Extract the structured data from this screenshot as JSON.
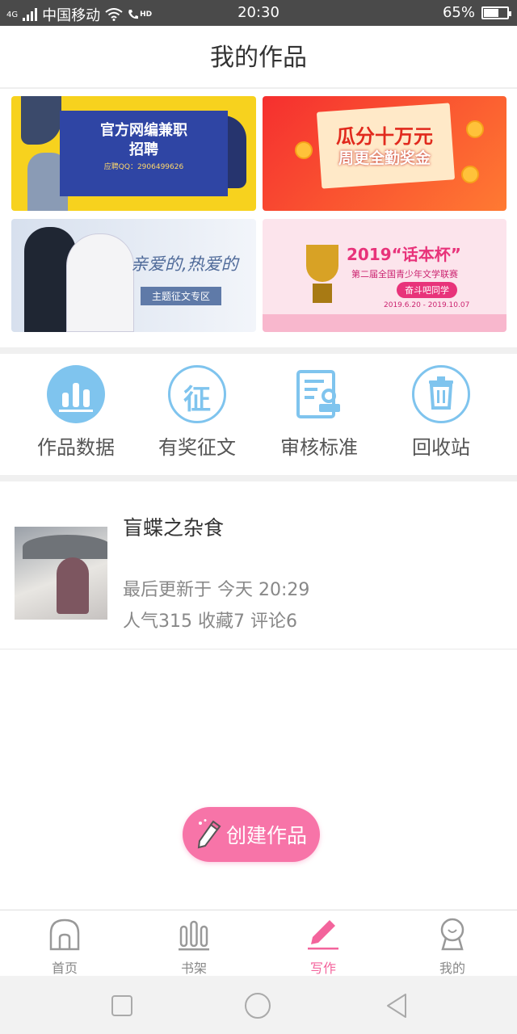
{
  "status_bar": {
    "network": "4G",
    "carrier": "中国移动",
    "hd": "HD",
    "time": "20:30",
    "battery_percent_label": "65%",
    "battery_level": 0.65
  },
  "header": {
    "title": "我的作品"
  },
  "banners": [
    {
      "title": "官方网编兼职",
      "subtitle": "招聘",
      "detail": "应聘QQ：2906499626"
    },
    {
      "title": "瓜分十万元",
      "subtitle": "周更全勤奖金"
    },
    {
      "title": "亲爱的,热爱的",
      "tag": "主题征文专区"
    },
    {
      "title": "2019“话本杯”",
      "subtitle": "第二届全国青少年文学联赛",
      "badge": "奋斗吧同学",
      "date": "2019.6.20 - 2019.10.07"
    }
  ],
  "quick_menu": [
    {
      "label": "作品数据",
      "icon": "bar-chart-icon"
    },
    {
      "label": "有奖征文",
      "icon": "contest-icon",
      "glyph": "征"
    },
    {
      "label": "审核标准",
      "icon": "review-standard-icon"
    },
    {
      "label": "回收站",
      "icon": "trash-icon"
    }
  ],
  "work": {
    "title": "盲蝶之杂食",
    "updated": "最后更新于 今天 20:29",
    "stats": "人气315 收藏7 评论6"
  },
  "create_button": {
    "label": "创建作品"
  },
  "tabbar": [
    {
      "label": "首页",
      "icon": "home-icon"
    },
    {
      "label": "书架",
      "icon": "bookshelf-icon"
    },
    {
      "label": "写作",
      "icon": "pen-icon",
      "active": true
    },
    {
      "label": "我的",
      "icon": "profile-icon"
    }
  ],
  "colors": {
    "accent": "#f3649c",
    "menu_icon": "#7fc4ee",
    "create_button": "#f774a8"
  }
}
